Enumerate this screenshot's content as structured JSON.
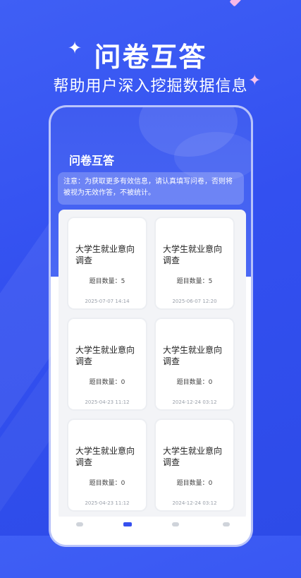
{
  "promo": {
    "title": "问卷互答",
    "subtitle": "帮助用户深入挖掘数据信息",
    "sparkle": "✦"
  },
  "app": {
    "header_title": "问卷互答",
    "notice": "注意：为获取更多有效信息，请认真填写问卷，否则将被视为无效作答，不被统计。",
    "accent_color": "#3650ef",
    "cards": [
      {
        "title": "大学生就业意向调查",
        "count": "题目数量：5",
        "date": "2025-07-07 14:14"
      },
      {
        "title": "大学生就业意向调查",
        "count": "题目数量：5",
        "date": "2025-06-07 12:20"
      },
      {
        "title": "大学生就业意向调查",
        "count": "题目数量：0",
        "date": "2025-04-23 11:12"
      },
      {
        "title": "大学生就业意向调查",
        "count": "题目数量：0",
        "date": "2024-12-24 03:12"
      },
      {
        "title": "大学生就业意向调查",
        "count": "题目数量：0",
        "date": "2025-04-23 11:12"
      },
      {
        "title": "大学生就业意向调查",
        "count": "题目数量：0",
        "date": "2024-12-24 03:12"
      }
    ],
    "tabs": [
      {
        "icon": "home-icon"
      },
      {
        "icon": "survey-icon"
      },
      {
        "icon": "message-icon"
      },
      {
        "icon": "profile-icon"
      }
    ]
  }
}
